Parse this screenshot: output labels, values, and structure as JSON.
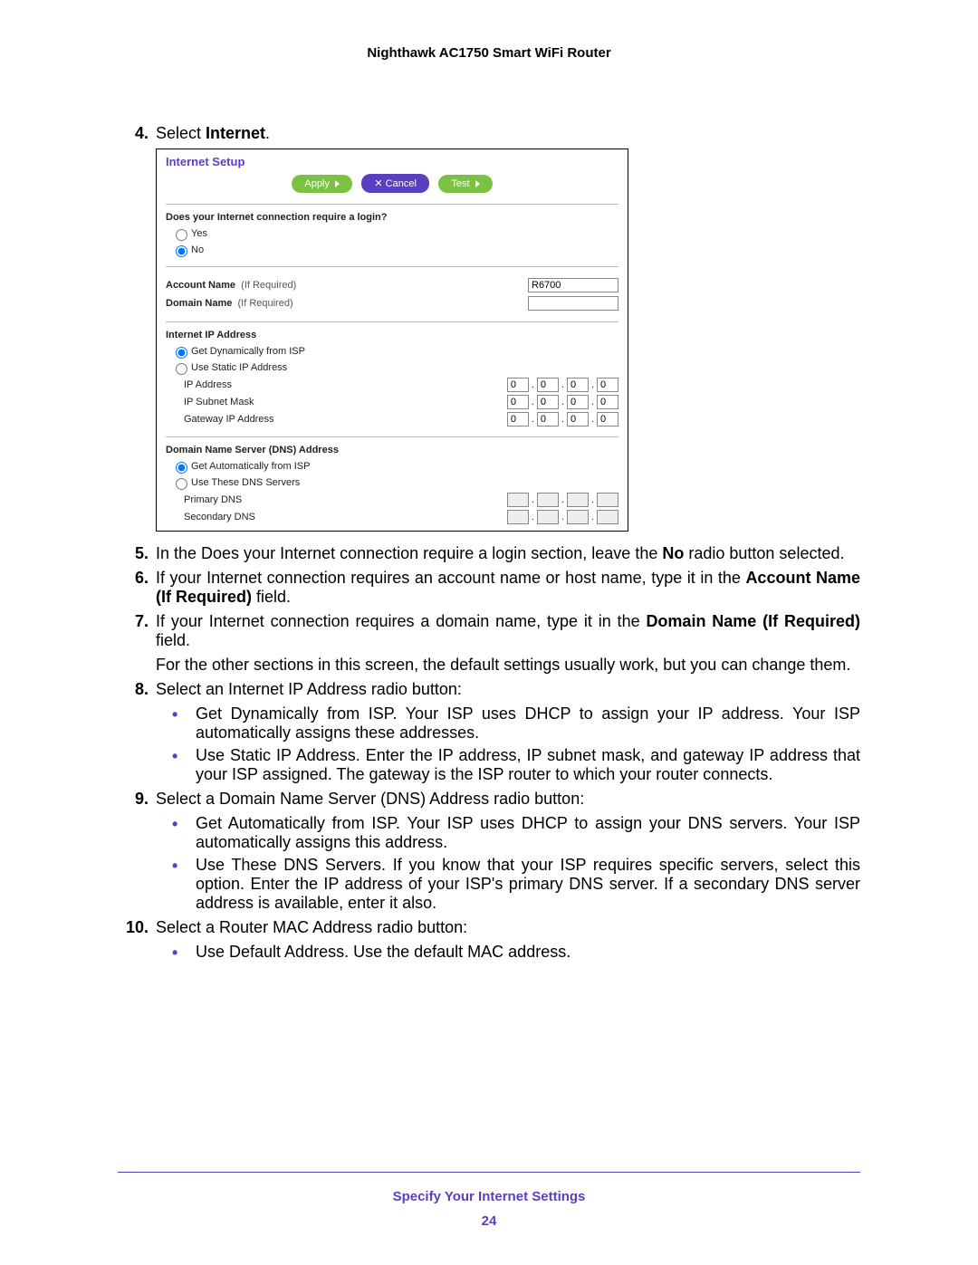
{
  "header": "Nighthawk AC1750 Smart WiFi Router",
  "step4": {
    "num": "4.",
    "pre": "Select ",
    "bold": "Internet",
    "post": "."
  },
  "shot": {
    "title": "Internet Setup",
    "btn_apply": "Apply",
    "btn_cancel": "✕ Cancel",
    "btn_test": "Test",
    "q_login": "Does your Internet connection require a login?",
    "yes": "Yes",
    "no": "No",
    "account_name": "Account Name",
    "if_required": "(If Required)",
    "domain_name": "Domain Name",
    "account_value": "R6700",
    "ip_title": "Internet IP Address",
    "ip_dyn": "Get Dynamically from ISP",
    "ip_static": "Use Static IP Address",
    "ip_addr": "IP Address",
    "ip_mask": "IP Subnet Mask",
    "ip_gw": "Gateway IP Address",
    "oct": "0",
    "dns_title": "Domain Name Server (DNS) Address",
    "dns_auto": "Get Automatically from ISP",
    "dns_use": "Use These DNS Servers",
    "dns_primary": "Primary DNS",
    "dns_secondary": "Secondary DNS"
  },
  "step5": {
    "num": "5.",
    "t1": "In the Does your Internet connection require a login section, leave the ",
    "b1": "No",
    "t2": " radio button selected."
  },
  "step6": {
    "num": "6.",
    "t1": "If your Internet connection requires an account name or host name, type it in the ",
    "b1": "Account Name (If Required)",
    "t2": " field."
  },
  "step7": {
    "num": "7.",
    "t1": "If your Internet connection requires a domain name, type it in the ",
    "b1": "Domain Name (If Required)",
    "t2": " field."
  },
  "note7": "For the other sections in this screen, the default settings usually work, but you can change them.",
  "step8": {
    "num": "8.",
    "t1": "Select an Internet IP Address radio button:"
  },
  "b8a": {
    "b": "Get Dynamically from ISP",
    "t": ". Your ISP uses DHCP to assign your IP address. Your ISP automatically assigns these addresses."
  },
  "b8b": {
    "b": "Use Static IP Address",
    "t": ". Enter the IP address, IP subnet mask, and gateway IP address that your ISP assigned. The gateway is the ISP router to which your router connects."
  },
  "step9": {
    "num": "9.",
    "t1": "Select a Domain Name Server (DNS) Address radio button:"
  },
  "b9a": {
    "b": "Get Automatically from ISP",
    "t": ". Your ISP uses DHCP to assign your DNS servers. Your ISP automatically assigns this address."
  },
  "b9b": {
    "b": "Use These DNS Servers",
    "t": ". If you know that your ISP requires specific servers, select this option. Enter the IP address of your ISP's primary DNS server. If a secondary DNS server address is available, enter it also."
  },
  "step10": {
    "num": "10.",
    "t1": "Select a Router MAC Address radio button:"
  },
  "b10a": {
    "b": "Use Default Address",
    "t": ". Use the default MAC address."
  },
  "footer": {
    "title": "Specify Your Internet Settings",
    "page": "24"
  }
}
